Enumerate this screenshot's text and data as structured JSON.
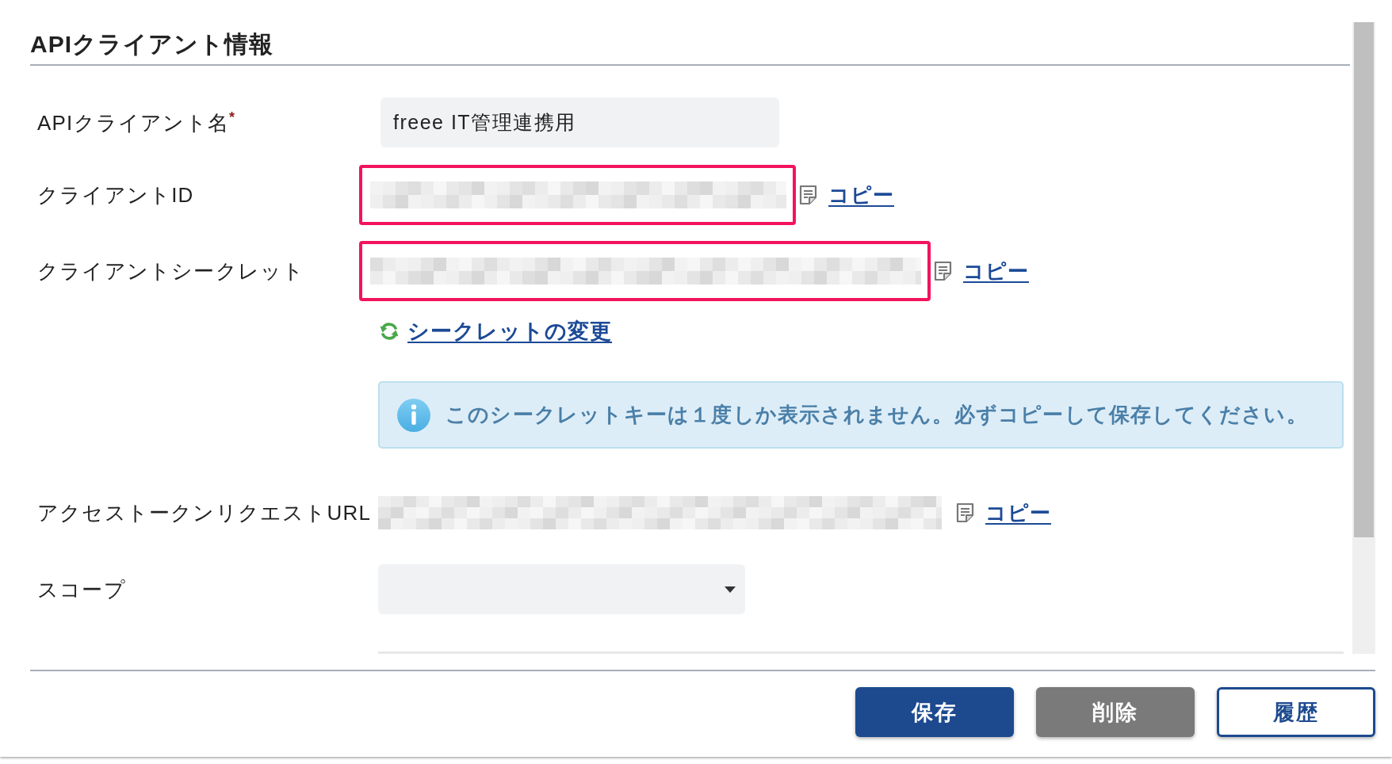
{
  "panel": {
    "title": "APIクライアント情報"
  },
  "fields": [
    {
      "kind": "text",
      "label": "APIクライアント名",
      "required_mark": "*",
      "value": "freee IT管理連携用"
    },
    {
      "kind": "masked",
      "label": "クライアントID",
      "highlighted": true,
      "copy_link": "コピー"
    },
    {
      "kind": "masked",
      "label": "クライアントシークレット",
      "highlighted": true,
      "copy_link": "コピー",
      "change_link": "シークレットの変更",
      "notice": "このシークレットキーは１度しか表示されません。必ずコピーして保存してください。"
    },
    {
      "kind": "masked",
      "label": "アクセストークンリクエストURL",
      "highlighted": false,
      "copy_link": "コピー"
    },
    {
      "kind": "select",
      "label": "スコープ"
    }
  ],
  "buttons": [
    {
      "kind": "primary",
      "label": "保存"
    },
    {
      "kind": "secondary",
      "label": "削除"
    },
    {
      "kind": "outline",
      "label": "履歴"
    }
  ]
}
